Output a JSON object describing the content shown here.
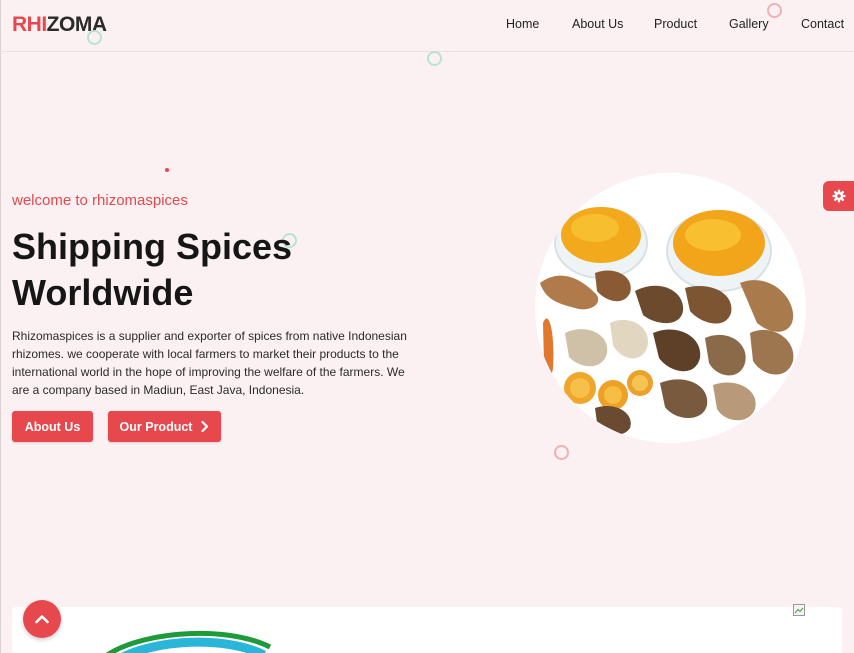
{
  "brand": {
    "part1": "RHI",
    "part2": "ZOMA"
  },
  "nav": [
    {
      "label": "Home"
    },
    {
      "label": "About Us"
    },
    {
      "label": "Product"
    },
    {
      "label": "Gallery"
    },
    {
      "label": "Contact"
    }
  ],
  "hero": {
    "welcome": "welcome to rhizomaspices",
    "title_line1": "Shipping Spices",
    "title_line2": "Worldwide",
    "description": "Rhizomaspices is a supplier and exporter of spices from native Indonesian rhizomes. we cooperate with local farmers to market their products to the international world in the hope of improving the welfare of the farmers. We are a company based in Madiun, East Java, Indonesia.",
    "btn_about": "About Us",
    "btn_product": "Our Product"
  },
  "icons": {
    "settings": "gear-icon",
    "scroll_top": "chevron-up-icon",
    "product_btn": "chevron-right-icon",
    "broken_image": "broken-image-icon"
  },
  "colors": {
    "accent": "#e6484d",
    "background": "#fbf1f2",
    "ring_green": "#b7e3d3",
    "ring_pink": "#efb1b4"
  }
}
